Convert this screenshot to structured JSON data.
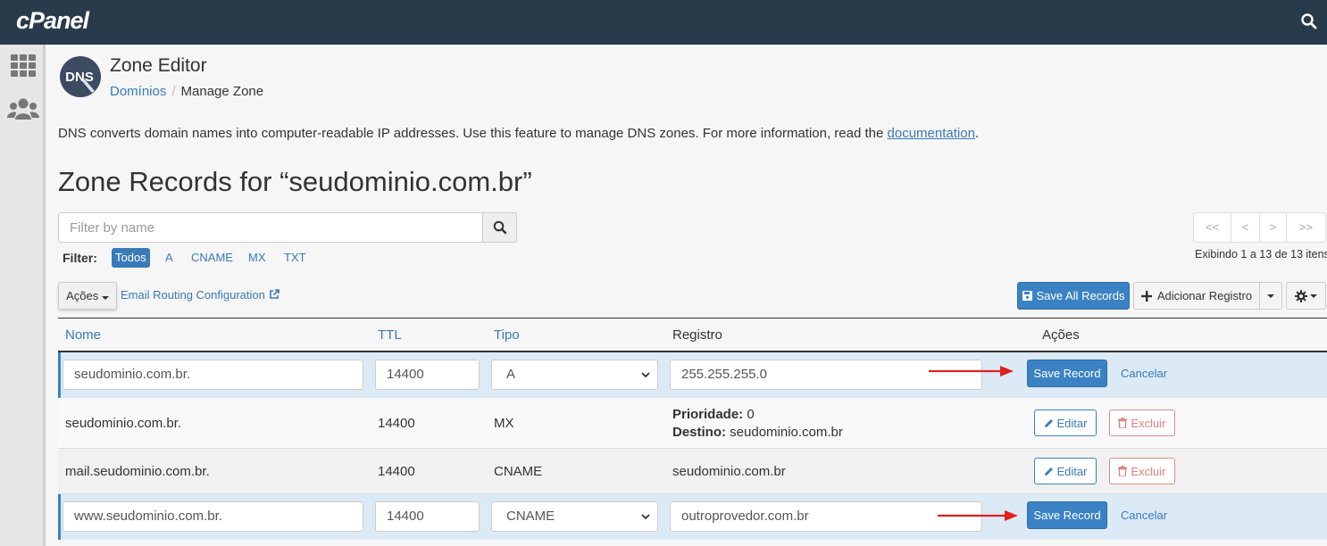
{
  "brand": {
    "logo": "cPanel"
  },
  "page": {
    "title": "Zone Editor",
    "breadcrumb": {
      "link": "Domínios",
      "separator": "/",
      "current": "Manage Zone"
    },
    "description_prefix": "DNS converts domain names into computer-readable IP addresses. Use this feature to manage DNS zones. For more information, read the ",
    "description_link": "documentation",
    "description_suffix": ".",
    "zone_title": "Zone Records for “seudominio.com.br”"
  },
  "search": {
    "placeholder": "Filter by name"
  },
  "filter": {
    "label": "Filter:",
    "tags": [
      "Todos",
      "A",
      "CNAME",
      "MX",
      "TXT"
    ],
    "active": "Todos"
  },
  "pagination": {
    "buttons": [
      "<<",
      "<",
      ">",
      ">>"
    ],
    "info": "Exibindo 1 a 13 de 13 itens"
  },
  "toolbar": {
    "acoes_label": "Ações",
    "email_routing": "Email Routing Configuration",
    "save_all": "Save All Records",
    "add_record": "Adicionar Registro"
  },
  "table": {
    "headers": {
      "nome": "Nome",
      "ttl": "TTL",
      "tipo": "Tipo",
      "registro": "Registro",
      "acoes": "Ações"
    },
    "rows": [
      {
        "mode": "edit",
        "name": "seudominio.com.br.",
        "ttl": "14400",
        "type": "A",
        "record": "255.255.255.0",
        "save": "Save Record",
        "cancel": "Cancelar"
      },
      {
        "mode": "view",
        "name": "seudominio.com.br.",
        "ttl": "14400",
        "type": "MX",
        "priority_label": "Prioridade:",
        "priority": "0",
        "dest_label": "Destino:",
        "dest": "seudominio.com.br",
        "edit": "Editar",
        "delete": "Excluir"
      },
      {
        "mode": "view",
        "name": "mail.seudominio.com.br.",
        "ttl": "14400",
        "type": "CNAME",
        "record": "seudominio.com.br",
        "edit": "Editar",
        "delete": "Excluir"
      },
      {
        "mode": "edit",
        "name": "www.seudominio.com.br.",
        "ttl": "14400",
        "type": "CNAME",
        "record": "outroprovedor.com.br",
        "save": "Save Record",
        "cancel": "Cancelar"
      }
    ]
  },
  "colors": {
    "topbar": "#293a4a",
    "primary": "#3a82c4",
    "link": "#3a7ab8",
    "danger": "#e0807d",
    "annotation_arrow": "#e02020"
  },
  "icons": [
    "search-icon",
    "grid-icon",
    "users-icon",
    "dns-icon",
    "external-link-icon",
    "floppy-icon",
    "plus-icon",
    "gear-icon",
    "pencil-icon",
    "trash-icon",
    "chevron-down-icon"
  ]
}
